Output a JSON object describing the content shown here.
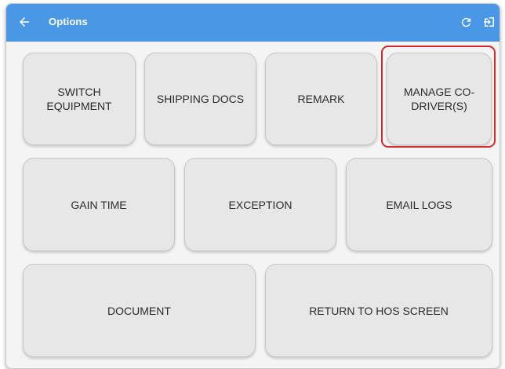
{
  "appbar": {
    "title": "Options",
    "background": "#4a97e6",
    "icons": {
      "back": "arrow-left-icon",
      "refresh": "refresh-icon",
      "logout": "logout-icon"
    }
  },
  "options": {
    "switch_equipment": "SWITCH EQUIPMENT",
    "shipping_docs": "SHIPPING DOCS",
    "remark": "REMARK",
    "manage_co_drivers": "MANAGE CO-DRIVER(S)",
    "gain_time": "GAIN TIME",
    "exception": "EXCEPTION",
    "email_logs": "EMAIL LOGS",
    "document": "DOCUMENT",
    "return_to_hos": "RETURN TO HOS SCREEN"
  },
  "highlight_color": "#d02a2a"
}
